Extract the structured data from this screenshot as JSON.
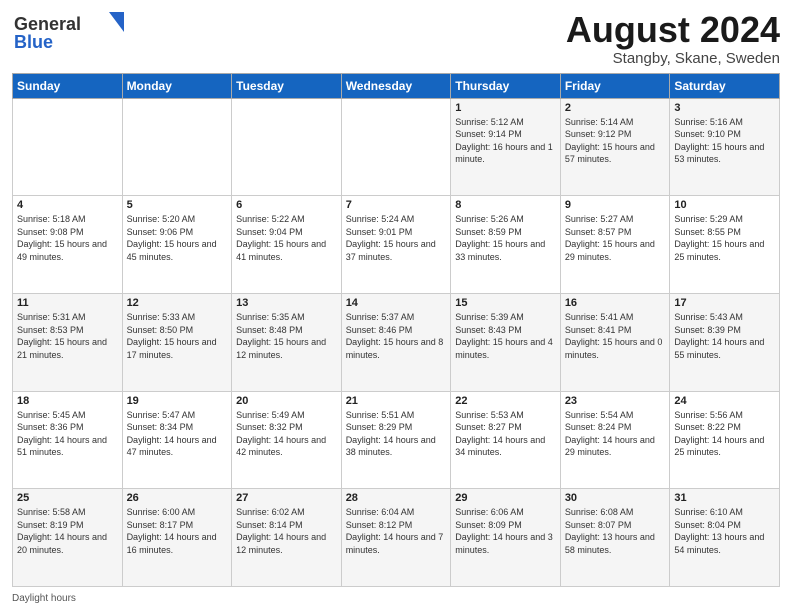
{
  "header": {
    "logo_general": "General",
    "logo_blue": "Blue",
    "month_title": "August 2024",
    "location": "Stangby, Skane, Sweden"
  },
  "footer": {
    "daylight_hours": "Daylight hours"
  },
  "days_of_week": [
    "Sunday",
    "Monday",
    "Tuesday",
    "Wednesday",
    "Thursday",
    "Friday",
    "Saturday"
  ],
  "weeks": [
    [
      {
        "day": "",
        "sunrise": "",
        "sunset": "",
        "daylight": ""
      },
      {
        "day": "",
        "sunrise": "",
        "sunset": "",
        "daylight": ""
      },
      {
        "day": "",
        "sunrise": "",
        "sunset": "",
        "daylight": ""
      },
      {
        "day": "",
        "sunrise": "",
        "sunset": "",
        "daylight": ""
      },
      {
        "day": "1",
        "sunrise": "Sunrise: 5:12 AM",
        "sunset": "Sunset: 9:14 PM",
        "daylight": "Daylight: 16 hours and 1 minute."
      },
      {
        "day": "2",
        "sunrise": "Sunrise: 5:14 AM",
        "sunset": "Sunset: 9:12 PM",
        "daylight": "Daylight: 15 hours and 57 minutes."
      },
      {
        "day": "3",
        "sunrise": "Sunrise: 5:16 AM",
        "sunset": "Sunset: 9:10 PM",
        "daylight": "Daylight: 15 hours and 53 minutes."
      }
    ],
    [
      {
        "day": "4",
        "sunrise": "Sunrise: 5:18 AM",
        "sunset": "Sunset: 9:08 PM",
        "daylight": "Daylight: 15 hours and 49 minutes."
      },
      {
        "day": "5",
        "sunrise": "Sunrise: 5:20 AM",
        "sunset": "Sunset: 9:06 PM",
        "daylight": "Daylight: 15 hours and 45 minutes."
      },
      {
        "day": "6",
        "sunrise": "Sunrise: 5:22 AM",
        "sunset": "Sunset: 9:04 PM",
        "daylight": "Daylight: 15 hours and 41 minutes."
      },
      {
        "day": "7",
        "sunrise": "Sunrise: 5:24 AM",
        "sunset": "Sunset: 9:01 PM",
        "daylight": "Daylight: 15 hours and 37 minutes."
      },
      {
        "day": "8",
        "sunrise": "Sunrise: 5:26 AM",
        "sunset": "Sunset: 8:59 PM",
        "daylight": "Daylight: 15 hours and 33 minutes."
      },
      {
        "day": "9",
        "sunrise": "Sunrise: 5:27 AM",
        "sunset": "Sunset: 8:57 PM",
        "daylight": "Daylight: 15 hours and 29 minutes."
      },
      {
        "day": "10",
        "sunrise": "Sunrise: 5:29 AM",
        "sunset": "Sunset: 8:55 PM",
        "daylight": "Daylight: 15 hours and 25 minutes."
      }
    ],
    [
      {
        "day": "11",
        "sunrise": "Sunrise: 5:31 AM",
        "sunset": "Sunset: 8:53 PM",
        "daylight": "Daylight: 15 hours and 21 minutes."
      },
      {
        "day": "12",
        "sunrise": "Sunrise: 5:33 AM",
        "sunset": "Sunset: 8:50 PM",
        "daylight": "Daylight: 15 hours and 17 minutes."
      },
      {
        "day": "13",
        "sunrise": "Sunrise: 5:35 AM",
        "sunset": "Sunset: 8:48 PM",
        "daylight": "Daylight: 15 hours and 12 minutes."
      },
      {
        "day": "14",
        "sunrise": "Sunrise: 5:37 AM",
        "sunset": "Sunset: 8:46 PM",
        "daylight": "Daylight: 15 hours and 8 minutes."
      },
      {
        "day": "15",
        "sunrise": "Sunrise: 5:39 AM",
        "sunset": "Sunset: 8:43 PM",
        "daylight": "Daylight: 15 hours and 4 minutes."
      },
      {
        "day": "16",
        "sunrise": "Sunrise: 5:41 AM",
        "sunset": "Sunset: 8:41 PM",
        "daylight": "Daylight: 15 hours and 0 minutes."
      },
      {
        "day": "17",
        "sunrise": "Sunrise: 5:43 AM",
        "sunset": "Sunset: 8:39 PM",
        "daylight": "Daylight: 14 hours and 55 minutes."
      }
    ],
    [
      {
        "day": "18",
        "sunrise": "Sunrise: 5:45 AM",
        "sunset": "Sunset: 8:36 PM",
        "daylight": "Daylight: 14 hours and 51 minutes."
      },
      {
        "day": "19",
        "sunrise": "Sunrise: 5:47 AM",
        "sunset": "Sunset: 8:34 PM",
        "daylight": "Daylight: 14 hours and 47 minutes."
      },
      {
        "day": "20",
        "sunrise": "Sunrise: 5:49 AM",
        "sunset": "Sunset: 8:32 PM",
        "daylight": "Daylight: 14 hours and 42 minutes."
      },
      {
        "day": "21",
        "sunrise": "Sunrise: 5:51 AM",
        "sunset": "Sunset: 8:29 PM",
        "daylight": "Daylight: 14 hours and 38 minutes."
      },
      {
        "day": "22",
        "sunrise": "Sunrise: 5:53 AM",
        "sunset": "Sunset: 8:27 PM",
        "daylight": "Daylight: 14 hours and 34 minutes."
      },
      {
        "day": "23",
        "sunrise": "Sunrise: 5:54 AM",
        "sunset": "Sunset: 8:24 PM",
        "daylight": "Daylight: 14 hours and 29 minutes."
      },
      {
        "day": "24",
        "sunrise": "Sunrise: 5:56 AM",
        "sunset": "Sunset: 8:22 PM",
        "daylight": "Daylight: 14 hours and 25 minutes."
      }
    ],
    [
      {
        "day": "25",
        "sunrise": "Sunrise: 5:58 AM",
        "sunset": "Sunset: 8:19 PM",
        "daylight": "Daylight: 14 hours and 20 minutes."
      },
      {
        "day": "26",
        "sunrise": "Sunrise: 6:00 AM",
        "sunset": "Sunset: 8:17 PM",
        "daylight": "Daylight: 14 hours and 16 minutes."
      },
      {
        "day": "27",
        "sunrise": "Sunrise: 6:02 AM",
        "sunset": "Sunset: 8:14 PM",
        "daylight": "Daylight: 14 hours and 12 minutes."
      },
      {
        "day": "28",
        "sunrise": "Sunrise: 6:04 AM",
        "sunset": "Sunset: 8:12 PM",
        "daylight": "Daylight: 14 hours and 7 minutes."
      },
      {
        "day": "29",
        "sunrise": "Sunrise: 6:06 AM",
        "sunset": "Sunset: 8:09 PM",
        "daylight": "Daylight: 14 hours and 3 minutes."
      },
      {
        "day": "30",
        "sunrise": "Sunrise: 6:08 AM",
        "sunset": "Sunset: 8:07 PM",
        "daylight": "Daylight: 13 hours and 58 minutes."
      },
      {
        "day": "31",
        "sunrise": "Sunrise: 6:10 AM",
        "sunset": "Sunset: 8:04 PM",
        "daylight": "Daylight: 13 hours and 54 minutes."
      }
    ]
  ]
}
